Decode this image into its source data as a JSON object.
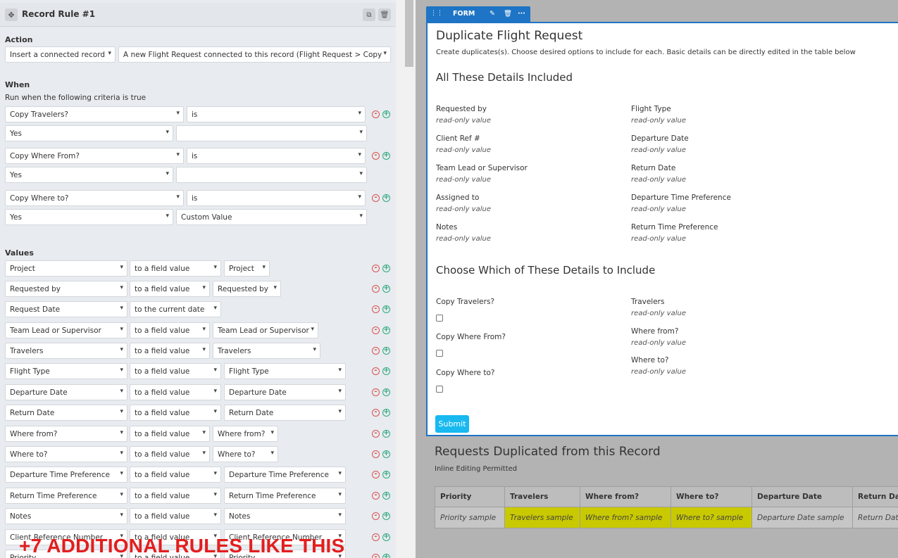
{
  "rule": {
    "title": "Record Rule #1"
  },
  "action": {
    "label": "Action",
    "type": "Insert a connected record",
    "target": "A new Flight Request connected to this record (Flight Request > Copy Recor"
  },
  "when": {
    "label": "When",
    "subtitle": "Run when the following criteria is true",
    "criteria": [
      {
        "field": "Copy Travelers?",
        "operator": "is",
        "value": "Yes",
        "extra": ""
      },
      {
        "field": "Copy Where From?",
        "operator": "is",
        "value": "Yes",
        "extra": ""
      },
      {
        "field": "Copy Where to?",
        "operator": "is",
        "value": "Yes",
        "extra": "Custom Value"
      }
    ]
  },
  "values": {
    "label": "Values",
    "rows": [
      {
        "field": "Project",
        "mode": "to a field value",
        "source": "Project"
      },
      {
        "field": "Requested by",
        "mode": "to a field value",
        "source": "Requested by"
      },
      {
        "field": "Request Date",
        "mode": "to the current date",
        "source": ""
      },
      {
        "field": "Team Lead or Supervisor",
        "mode": "to a field value",
        "source": "Team Lead or Supervisor"
      },
      {
        "field": "Travelers",
        "mode": "to a field value",
        "source": "Travelers"
      },
      {
        "field": "Flight Type",
        "mode": "to a field value",
        "source": "Flight Type"
      },
      {
        "field": "Departure Date",
        "mode": "to a field value",
        "source": "Departure Date"
      },
      {
        "field": "Return Date",
        "mode": "to a field value",
        "source": "Return Date"
      },
      {
        "field": "Where from?",
        "mode": "to a field value",
        "source": "Where from?"
      },
      {
        "field": "Where to?",
        "mode": "to a field value",
        "source": "Where to?"
      },
      {
        "field": "Departure Time Preference",
        "mode": "to a field value",
        "source": "Departure Time Preference"
      },
      {
        "field": "Return Time Preference",
        "mode": "to a field value",
        "source": "Return Time Preference"
      },
      {
        "field": "Notes",
        "mode": "to a field value",
        "source": "Notes"
      },
      {
        "field": "Client Reference Number",
        "mode": "to a field value",
        "source": "Client Reference Number"
      },
      {
        "field": "Priority",
        "mode": "to a field value",
        "source": "Priority"
      }
    ]
  },
  "overlay_text": "+7 ADDITIONAL RULES LIKE THIS",
  "toolbar": {
    "label": "FORM"
  },
  "form": {
    "title": "Duplicate Flight Request",
    "description": "Create duplicates(s). Choose desired options to include for each. Basic details can be directly edited in the table below",
    "section1": "All These Details Included",
    "readonly": "read-only value",
    "left_fields": [
      "Requested by",
      "Client Ref #",
      "Team Lead or Supervisor",
      "Assigned to",
      "Notes"
    ],
    "right_fields": [
      "Flight Type",
      "Departure Date",
      "Return Date",
      "Departure Time Preference",
      "Return Time Preference"
    ],
    "section2": "Choose Which of These Details to Include",
    "checkbox_fields": [
      "Copy Travelers?",
      "Copy Where From?",
      "Copy Where to?"
    ],
    "right_fields2": [
      "Travelers",
      "Where from?",
      "Where to?"
    ],
    "submit": "Submit"
  },
  "requests": {
    "title": "Requests Duplicated from this Record",
    "subtitle": "Inline Editing Permitted",
    "columns": [
      "Priority",
      "Travelers",
      "Where from?",
      "Where to?",
      "Departure Date",
      "Return Date"
    ],
    "row": [
      "Priority sample",
      "Travelers sample",
      "Where from? sample",
      "Where to? sample",
      "Departure Date sample",
      "Return Date sample"
    ]
  }
}
